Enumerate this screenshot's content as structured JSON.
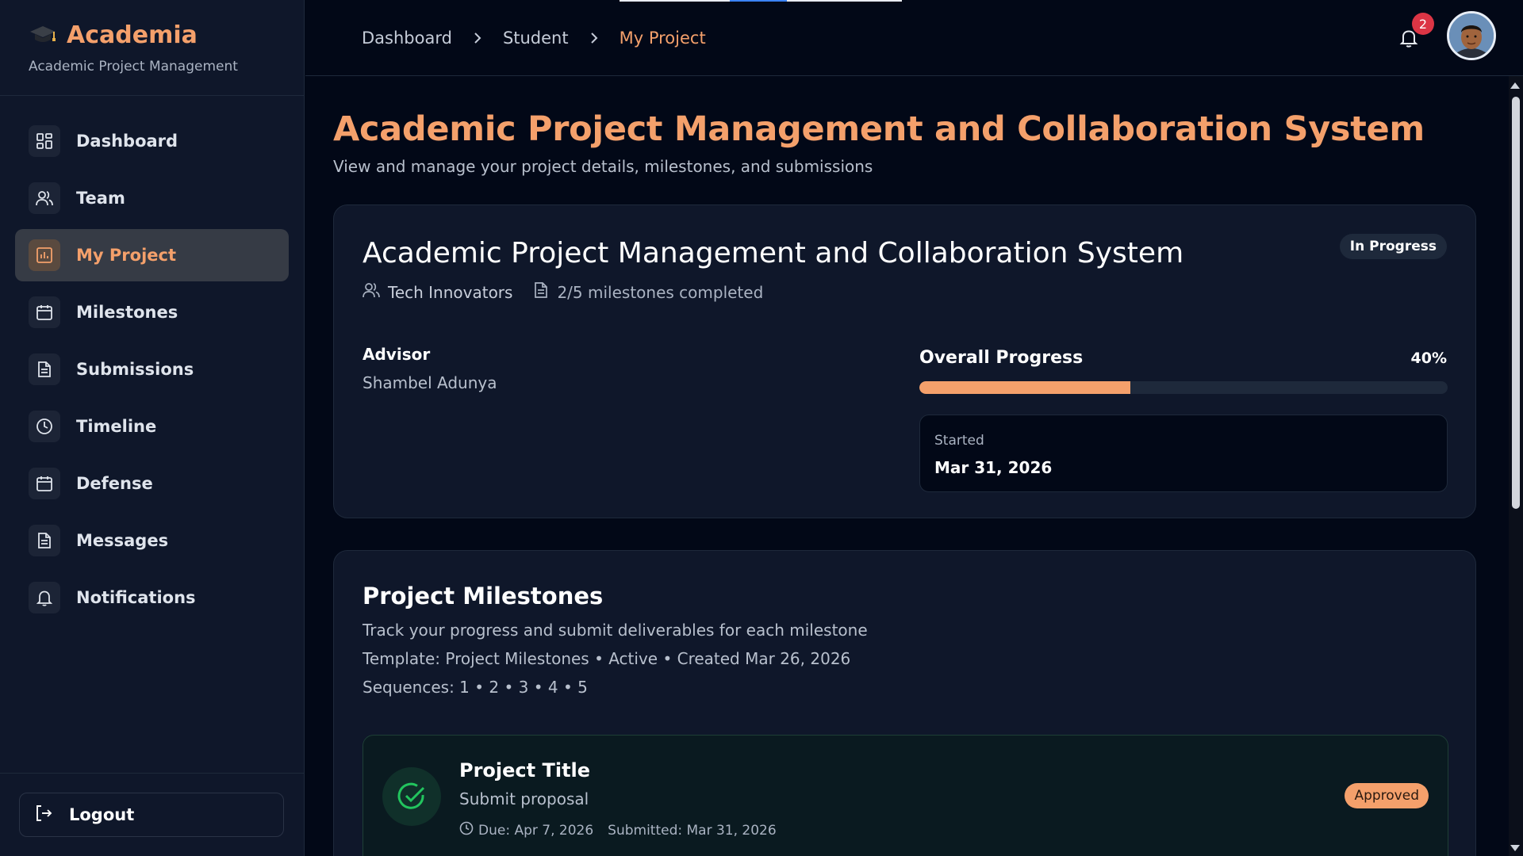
{
  "app": {
    "name": "Academia",
    "subtitle": "Academic Project Management"
  },
  "sidebar": {
    "items": [
      {
        "label": "Dashboard",
        "icon": "dashboard-grid-icon",
        "active": false
      },
      {
        "label": "Team",
        "icon": "users-icon",
        "active": false
      },
      {
        "label": "My Project",
        "icon": "project-chart-icon",
        "active": true
      },
      {
        "label": "Milestones",
        "icon": "calendar-icon",
        "active": false
      },
      {
        "label": "Submissions",
        "icon": "document-icon",
        "active": false
      },
      {
        "label": "Timeline",
        "icon": "clock-icon",
        "active": false
      },
      {
        "label": "Defense",
        "icon": "calendar-icon",
        "active": false
      },
      {
        "label": "Messages",
        "icon": "document-icon",
        "active": false
      },
      {
        "label": "Notifications",
        "icon": "bell-icon",
        "active": false
      }
    ],
    "logout_label": "Logout"
  },
  "topbar": {
    "breadcrumb": [
      "Dashboard",
      "Student",
      "My Project"
    ],
    "notification_count": "2"
  },
  "page": {
    "title": "Academic Project Management and Collaboration System",
    "subtitle": "View and manage your project details, milestones, and submissions"
  },
  "project": {
    "title": "Academic Project Management and Collaboration System",
    "status": "In Progress",
    "team": "Tech Innovators",
    "milestones_summary": "2/5 milestones completed",
    "advisor_label": "Advisor",
    "advisor_name": "Shambel Adunya",
    "progress_label": "Overall Progress",
    "progress_text": "40%",
    "progress_value": 0.4,
    "started_label": "Started",
    "started_date": "Mar 31, 2026"
  },
  "milestones": {
    "title": "Project Milestones",
    "description": "Track your progress and submit deliverables for each milestone",
    "template_line": "Template: Project Milestones • Active • Created Mar 26, 2026",
    "sequences_line": "Sequences: 1 • 2 • 3 • 4 • 5",
    "items": [
      {
        "title": "Project Title",
        "description": "Submit proposal",
        "due": "Due: Apr 7, 2026",
        "submitted": "Submitted: Mar 31, 2026",
        "status": "Approved"
      }
    ]
  },
  "colors": {
    "accent": "#f4a06b",
    "background": "#020817",
    "card": "#0f172a",
    "success": "#22c55e",
    "badge": "#dc3545"
  }
}
